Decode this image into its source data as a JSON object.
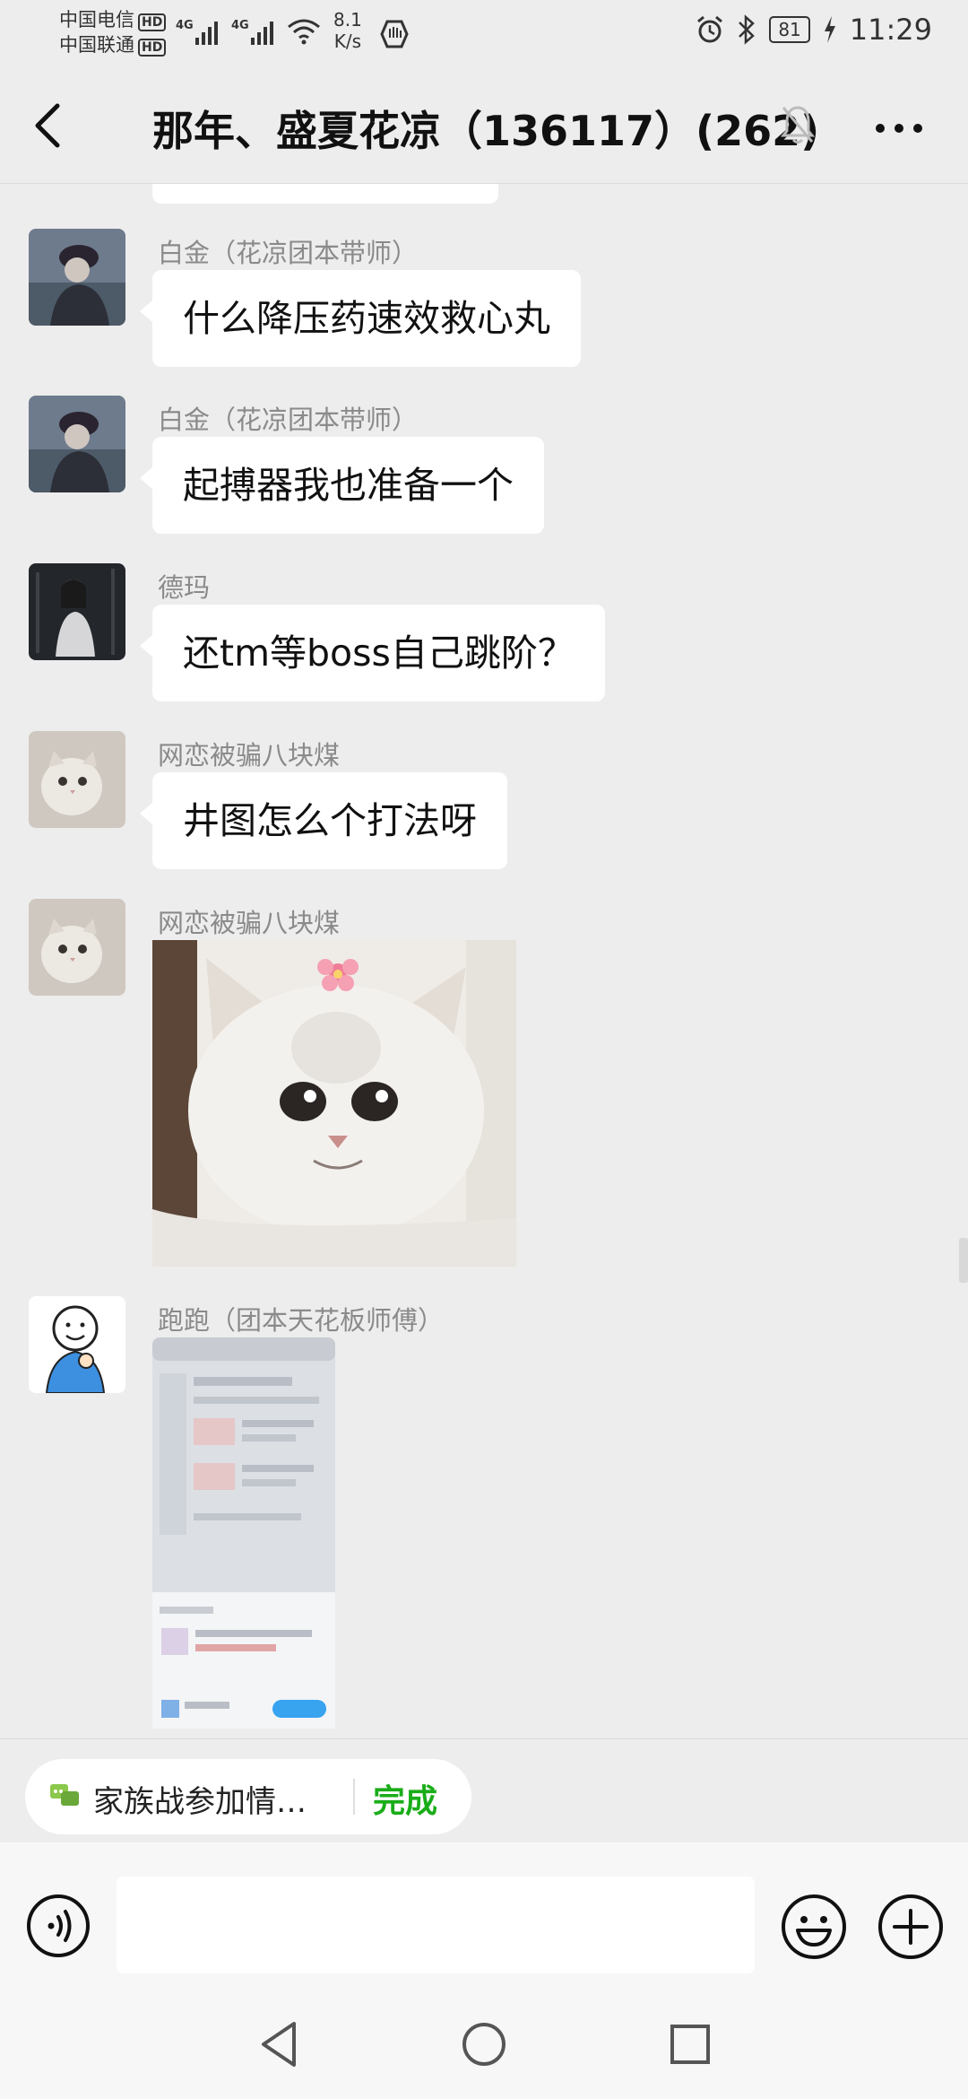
{
  "status_bar": {
    "carrier_1": "中国电信",
    "carrier_2": "中国联通",
    "hd_badge": "HD",
    "network_type": "4G",
    "net_speed": "8.1",
    "net_speed_unit": "K/s",
    "battery": "81",
    "time": "11:29"
  },
  "header": {
    "title": "那年、盛夏花凉（136117）(262)"
  },
  "messages": [
    {
      "sender": "白金（花凉团本带师）",
      "text": "什么降压药速效救心丸"
    },
    {
      "sender": "白金（花凉团本带师）",
      "text": "起搏器我也准备一个"
    },
    {
      "sender": "德玛",
      "text": "还tm等boss自己跳阶？"
    },
    {
      "sender": "网恋被骗八块煤",
      "text": "井图怎么个打法呀"
    },
    {
      "sender": "网恋被骗八块煤",
      "image": "cat-sticker"
    },
    {
      "sender": "跑跑（团本天花板师傅）",
      "image": "screenshot-thumbnail"
    }
  ],
  "quick_reply": {
    "text": "家族战参加情…",
    "done_label": "完成"
  },
  "input": {
    "placeholder": ""
  },
  "colors": {
    "background": "#ededed",
    "bubble": "#ffffff",
    "accent_green": "#1aad19",
    "sender_gray": "#8a8a8a"
  }
}
